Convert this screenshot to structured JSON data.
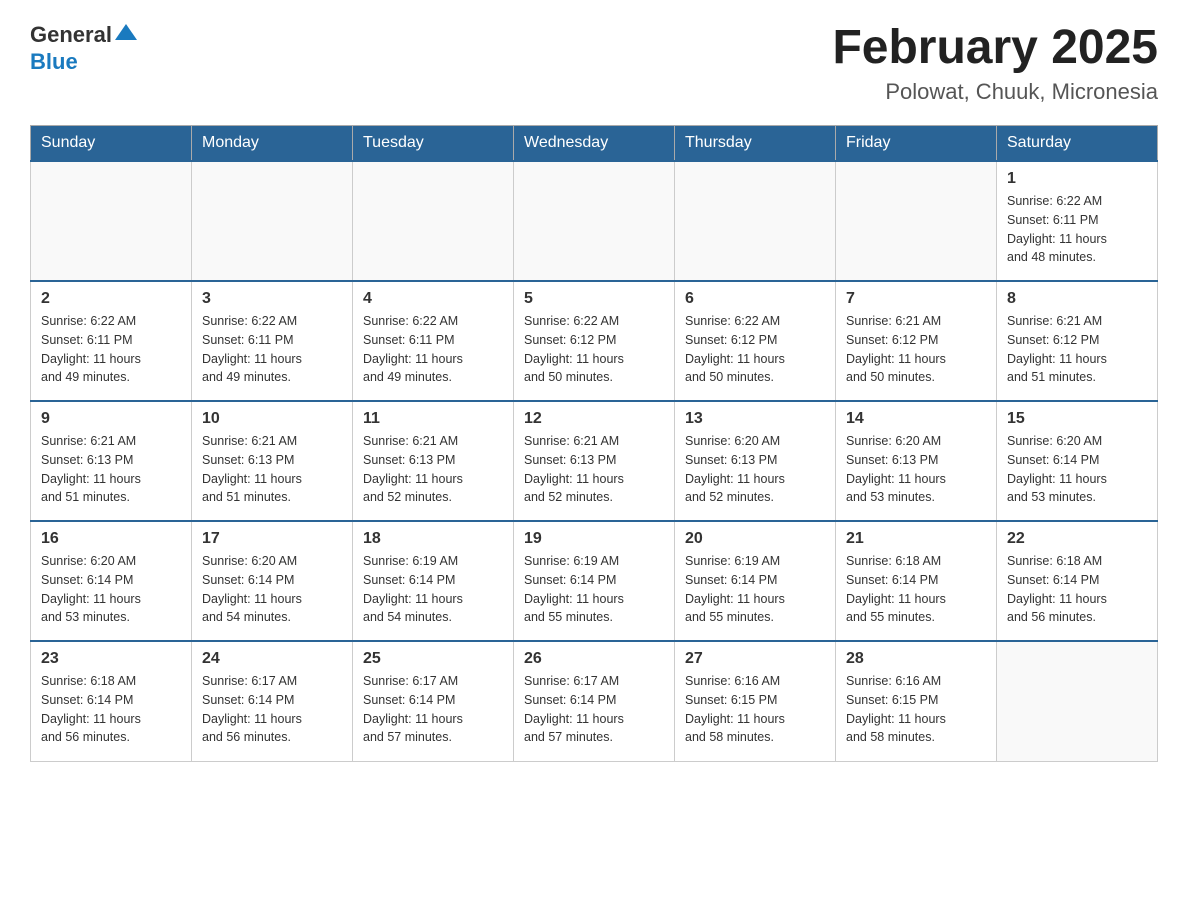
{
  "header": {
    "logo_general": "General",
    "logo_blue": "Blue",
    "month_title": "February 2025",
    "location": "Polowat, Chuuk, Micronesia"
  },
  "weekdays": [
    "Sunday",
    "Monday",
    "Tuesday",
    "Wednesday",
    "Thursday",
    "Friday",
    "Saturday"
  ],
  "weeks": [
    [
      {
        "day": "",
        "info": ""
      },
      {
        "day": "",
        "info": ""
      },
      {
        "day": "",
        "info": ""
      },
      {
        "day": "",
        "info": ""
      },
      {
        "day": "",
        "info": ""
      },
      {
        "day": "",
        "info": ""
      },
      {
        "day": "1",
        "info": "Sunrise: 6:22 AM\nSunset: 6:11 PM\nDaylight: 11 hours\nand 48 minutes."
      }
    ],
    [
      {
        "day": "2",
        "info": "Sunrise: 6:22 AM\nSunset: 6:11 PM\nDaylight: 11 hours\nand 49 minutes."
      },
      {
        "day": "3",
        "info": "Sunrise: 6:22 AM\nSunset: 6:11 PM\nDaylight: 11 hours\nand 49 minutes."
      },
      {
        "day": "4",
        "info": "Sunrise: 6:22 AM\nSunset: 6:11 PM\nDaylight: 11 hours\nand 49 minutes."
      },
      {
        "day": "5",
        "info": "Sunrise: 6:22 AM\nSunset: 6:12 PM\nDaylight: 11 hours\nand 50 minutes."
      },
      {
        "day": "6",
        "info": "Sunrise: 6:22 AM\nSunset: 6:12 PM\nDaylight: 11 hours\nand 50 minutes."
      },
      {
        "day": "7",
        "info": "Sunrise: 6:21 AM\nSunset: 6:12 PM\nDaylight: 11 hours\nand 50 minutes."
      },
      {
        "day": "8",
        "info": "Sunrise: 6:21 AM\nSunset: 6:12 PM\nDaylight: 11 hours\nand 51 minutes."
      }
    ],
    [
      {
        "day": "9",
        "info": "Sunrise: 6:21 AM\nSunset: 6:13 PM\nDaylight: 11 hours\nand 51 minutes."
      },
      {
        "day": "10",
        "info": "Sunrise: 6:21 AM\nSunset: 6:13 PM\nDaylight: 11 hours\nand 51 minutes."
      },
      {
        "day": "11",
        "info": "Sunrise: 6:21 AM\nSunset: 6:13 PM\nDaylight: 11 hours\nand 52 minutes."
      },
      {
        "day": "12",
        "info": "Sunrise: 6:21 AM\nSunset: 6:13 PM\nDaylight: 11 hours\nand 52 minutes."
      },
      {
        "day": "13",
        "info": "Sunrise: 6:20 AM\nSunset: 6:13 PM\nDaylight: 11 hours\nand 52 minutes."
      },
      {
        "day": "14",
        "info": "Sunrise: 6:20 AM\nSunset: 6:13 PM\nDaylight: 11 hours\nand 53 minutes."
      },
      {
        "day": "15",
        "info": "Sunrise: 6:20 AM\nSunset: 6:14 PM\nDaylight: 11 hours\nand 53 minutes."
      }
    ],
    [
      {
        "day": "16",
        "info": "Sunrise: 6:20 AM\nSunset: 6:14 PM\nDaylight: 11 hours\nand 53 minutes."
      },
      {
        "day": "17",
        "info": "Sunrise: 6:20 AM\nSunset: 6:14 PM\nDaylight: 11 hours\nand 54 minutes."
      },
      {
        "day": "18",
        "info": "Sunrise: 6:19 AM\nSunset: 6:14 PM\nDaylight: 11 hours\nand 54 minutes."
      },
      {
        "day": "19",
        "info": "Sunrise: 6:19 AM\nSunset: 6:14 PM\nDaylight: 11 hours\nand 55 minutes."
      },
      {
        "day": "20",
        "info": "Sunrise: 6:19 AM\nSunset: 6:14 PM\nDaylight: 11 hours\nand 55 minutes."
      },
      {
        "day": "21",
        "info": "Sunrise: 6:18 AM\nSunset: 6:14 PM\nDaylight: 11 hours\nand 55 minutes."
      },
      {
        "day": "22",
        "info": "Sunrise: 6:18 AM\nSunset: 6:14 PM\nDaylight: 11 hours\nand 56 minutes."
      }
    ],
    [
      {
        "day": "23",
        "info": "Sunrise: 6:18 AM\nSunset: 6:14 PM\nDaylight: 11 hours\nand 56 minutes."
      },
      {
        "day": "24",
        "info": "Sunrise: 6:17 AM\nSunset: 6:14 PM\nDaylight: 11 hours\nand 56 minutes."
      },
      {
        "day": "25",
        "info": "Sunrise: 6:17 AM\nSunset: 6:14 PM\nDaylight: 11 hours\nand 57 minutes."
      },
      {
        "day": "26",
        "info": "Sunrise: 6:17 AM\nSunset: 6:14 PM\nDaylight: 11 hours\nand 57 minutes."
      },
      {
        "day": "27",
        "info": "Sunrise: 6:16 AM\nSunset: 6:15 PM\nDaylight: 11 hours\nand 58 minutes."
      },
      {
        "day": "28",
        "info": "Sunrise: 6:16 AM\nSunset: 6:15 PM\nDaylight: 11 hours\nand 58 minutes."
      },
      {
        "day": "",
        "info": ""
      }
    ]
  ]
}
